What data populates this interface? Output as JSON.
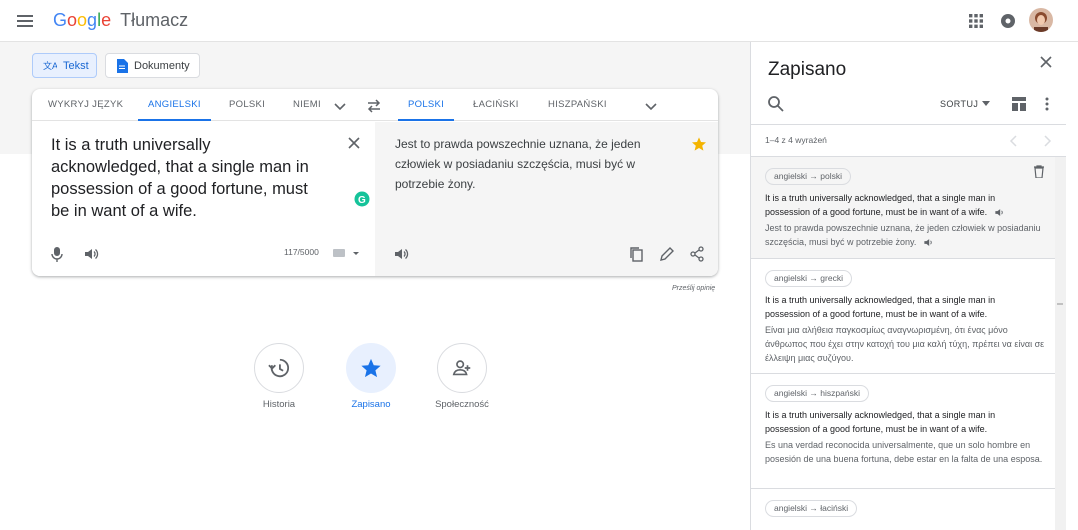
{
  "header": {
    "logo_letters": [
      "G",
      "o",
      "o",
      "g",
      "l",
      "e"
    ],
    "product": "Tłumacz",
    "icons": [
      "menu-icon",
      "apps-icon",
      "notifications-icon",
      "avatar"
    ]
  },
  "modes": {
    "text_label": "Tekst",
    "documents_label": "Dokumenty"
  },
  "source_langs": [
    "WYKRYJ JĘZYK",
    "ANGIELSKI",
    "POLSKI",
    "NIEMI"
  ],
  "target_langs": [
    "POLSKI",
    "ŁACIŃSKI",
    "HISZPAŃSKI"
  ],
  "source": {
    "text": "It is a truth universally acknowledged, that a single man in possession of a good fortune, must be in want of a wife.",
    "char_count": "117/5000"
  },
  "target": {
    "text": "Jest to prawda powszechnie uznana, że jeden człowiek w posiadaniu szczęścia, musi być w potrzebie żony."
  },
  "feedback": "Prześlij opinię",
  "bottom_buttons": {
    "history": "Historia",
    "saved": "Zapisano",
    "community": "Społeczność"
  },
  "panel": {
    "title": "Zapisano",
    "sort_label": "SORTUJ",
    "count": "1–4 z 4 wyrażeń",
    "items": [
      {
        "pair": "angielski → polski",
        "source": "It is a truth universally acknowledged, that a single man in possession of a good fortune, must be in want of a wife.",
        "target": "Jest to prawda powszechnie uznana, że jeden człowiek w posiadaniu szczęścia, musi być w potrzebie żony."
      },
      {
        "pair": "angielski → grecki",
        "source": "It is a truth universally acknowledged, that a single man in possession of a good fortune, must be in want of a wife.",
        "target": "Είναι μια αλήθεια παγκοσμίως αναγνωρισμένη, ότι ένας μόνο άνθρωπος που έχει στην κατοχή του μια καλή τύχη, πρέπει να είναι σε έλλειψη μιας συζύγου."
      },
      {
        "pair": "angielski → hiszpański",
        "source": "It is a truth universally acknowledged, that a single man in possession of a good fortune, must be in want of a wife.",
        "target": "Es una verdad reconocida universalmente, que un solo hombre en posesión de una buena fortuna, debe estar en la falta de una esposa."
      },
      {
        "pair": "angielski → łaciński"
      }
    ]
  },
  "colors": {
    "accent": "#1a73e8",
    "star": "#f4b400",
    "grammarly": "#15c39a"
  }
}
